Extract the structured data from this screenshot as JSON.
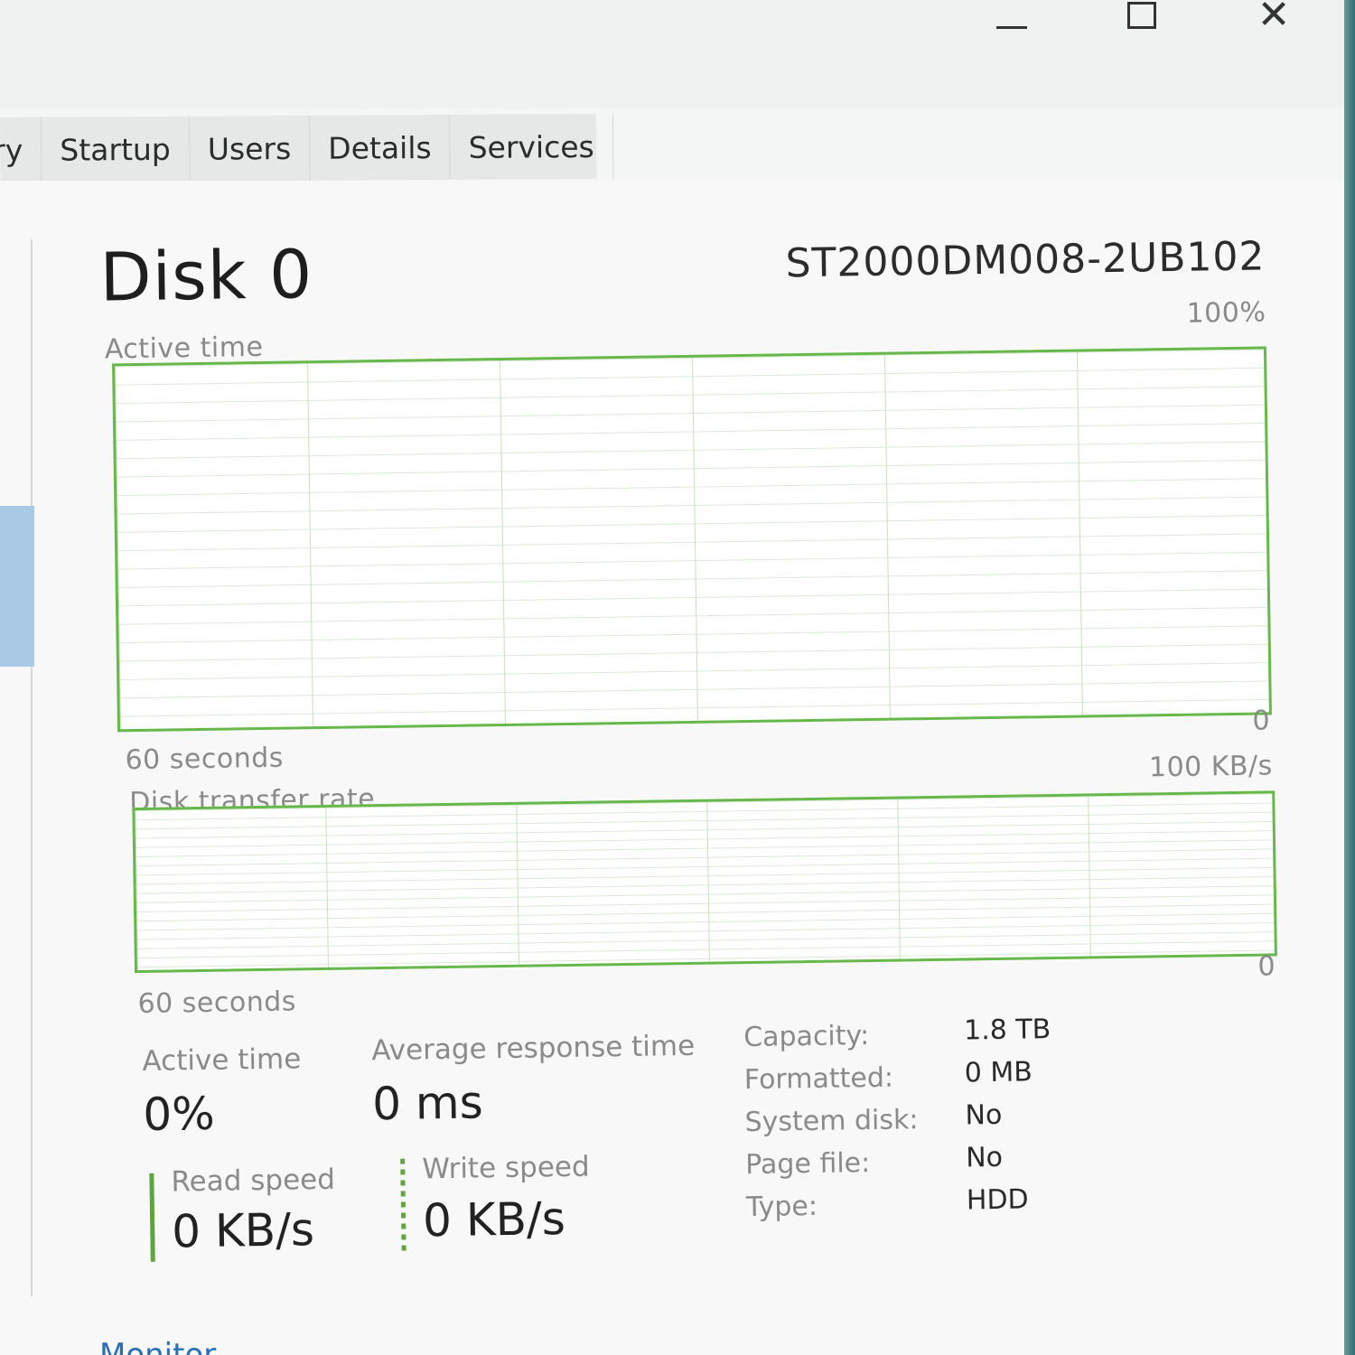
{
  "window": {
    "close_symbol": "✕"
  },
  "tabs": [
    "ry",
    "Startup",
    "Users",
    "Details",
    "Services"
  ],
  "disk": {
    "title": "Disk 0",
    "model": "ST2000DM008-2UB102"
  },
  "charts": {
    "active_time": {
      "label": "Active time",
      "max_label": "100%",
      "min_label": "0",
      "time_label": "60 seconds"
    },
    "transfer_rate": {
      "label": "Disk transfer rate",
      "max_label": "100 KB/s",
      "min_label": "0",
      "time_label": "60 seconds"
    }
  },
  "stats": {
    "active_time": {
      "label": "Active time",
      "value": "0%"
    },
    "avg_response": {
      "label": "Average response time",
      "value": "0 ms"
    },
    "read_speed": {
      "label": "Read speed",
      "value": "0 KB/s"
    },
    "write_speed": {
      "label": "Write speed",
      "value": "0 KB/s"
    }
  },
  "properties": [
    {
      "label": "Capacity:",
      "value": "1.8 TB"
    },
    {
      "label": "Formatted:",
      "value": "0 MB"
    },
    {
      "label": "System disk:",
      "value": "No"
    },
    {
      "label": "Page file:",
      "value": "No"
    },
    {
      "label": "Type:",
      "value": "HDD"
    }
  ],
  "footer": {
    "monitor_link": "Monitor"
  },
  "colors": {
    "graph_accent": "#66b84a",
    "sidebar_selected": "#a9c9e5",
    "link": "#2a6fb8"
  }
}
